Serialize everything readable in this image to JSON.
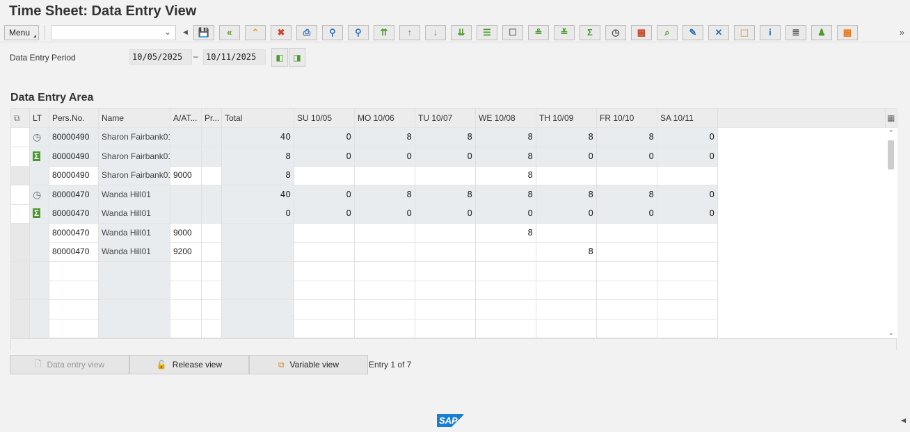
{
  "title": "Time Sheet: Data Entry View",
  "toolbar": {
    "menu": "Menu",
    "command_value": "",
    "icons": [
      "save-icon",
      "back-icon",
      "exit-icon",
      "cancel-icon",
      "print-icon",
      "find-icon",
      "find-next-icon",
      "first-page-icon",
      "previous-page-icon",
      "next-page-icon",
      "last-page-icon",
      "select-all-icon",
      "deselect-all-icon",
      "sort-ascending-icon",
      "sort-descending-icon",
      "total-icon",
      "clock-icon",
      "calendar-icon",
      "details-icon",
      "edit-icon",
      "delete-icon",
      "assign-icon",
      "info-icon",
      "overview-icon",
      "personnel-icon",
      "layout-icon"
    ]
  },
  "period": {
    "label": "Data Entry Period",
    "from": "10/05/2025",
    "sep": "–",
    "to": "10/11/2025"
  },
  "area_title": "Data Entry Area",
  "columns": [
    "LT",
    "Pers.No.",
    "Name",
    "A/AT...",
    "Pr...",
    "Total",
    "SU   10/05",
    "MO   10/06",
    "TU   10/07",
    "WE   10/08",
    "TH   10/09",
    "FR   10/10",
    "SA   10/11"
  ],
  "rows": [
    {
      "lt": "clock",
      "pers": "80000490",
      "name": "Sharon Fairbank01",
      "aa": "",
      "pr": "",
      "total": "40",
      "days": [
        "0",
        "8",
        "8",
        "8",
        "8",
        "8",
        "0"
      ]
    },
    {
      "lt": "sigma",
      "pers": "80000490",
      "name": "Sharon Fairbank01",
      "aa": "",
      "pr": "",
      "total": "8",
      "days": [
        "0",
        "0",
        "0",
        "8",
        "0",
        "0",
        "0"
      ]
    },
    {
      "lt": "",
      "pers": "80000490",
      "name": "Sharon Fairbank01",
      "aa": "9000",
      "pr": "",
      "total": "8",
      "days": [
        "",
        "",
        "",
        "8",
        "",
        "",
        ""
      ]
    },
    {
      "lt": "clock",
      "pers": "80000470",
      "name": "Wanda Hill01",
      "aa": "",
      "pr": "",
      "total": "40",
      "days": [
        "0",
        "8",
        "8",
        "8",
        "8",
        "8",
        "0"
      ]
    },
    {
      "lt": "sigma",
      "pers": "80000470",
      "name": "Wanda Hill01",
      "aa": "",
      "pr": "",
      "total": "0",
      "days": [
        "0",
        "0",
        "0",
        "0",
        "0",
        "0",
        "0"
      ]
    },
    {
      "lt": "",
      "pers": "80000470",
      "name": "Wanda Hill01",
      "aa": "9000",
      "pr": "",
      "total": "",
      "days": [
        "",
        "",
        "",
        "8",
        "",
        "",
        ""
      ]
    },
    {
      "lt": "",
      "pers": "80000470",
      "name": "Wanda Hill01",
      "aa": "9200",
      "pr": "",
      "total": "",
      "days": [
        "",
        "",
        "",
        "",
        "8",
        "",
        ""
      ]
    }
  ],
  "buttons": {
    "data_entry": "Data entry view",
    "release": "Release view",
    "variable": "Variable view"
  },
  "entry_status": "Entry 1 of 7",
  "logo": "SAP"
}
